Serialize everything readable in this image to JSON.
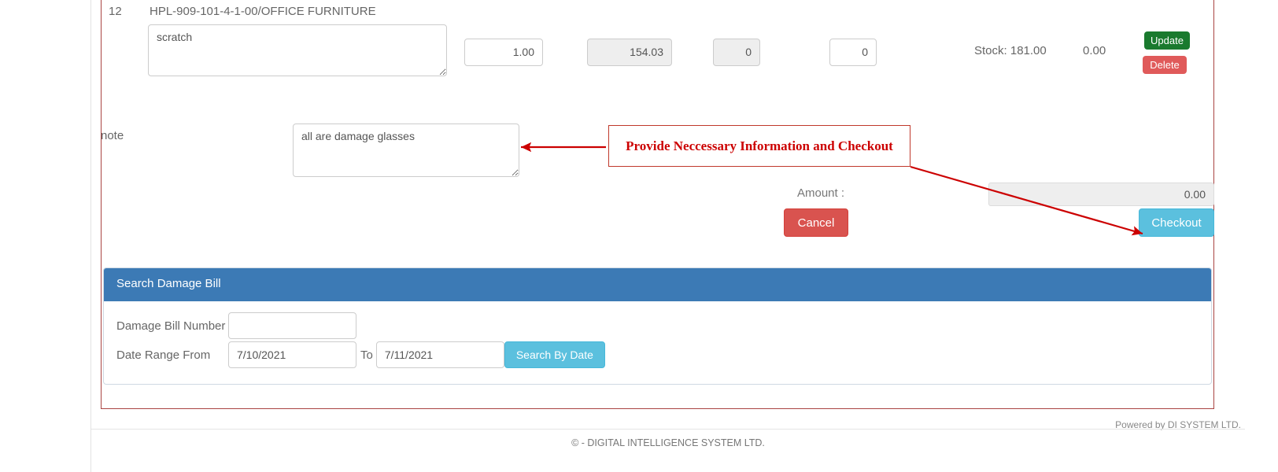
{
  "item_row": {
    "serial": "12",
    "code": "HPL-909-101-4-1-00/OFFICE FURNITURE",
    "remarks": "scratch",
    "quantity": "1.00",
    "rate": "154.03",
    "discount": "0",
    "vat": "0",
    "stock": "Stock: 181.00",
    "line_total": "0.00",
    "update_label": "Update",
    "delete_label": "Delete",
    "update_color": "#1a7a2e",
    "delete_color": "#e05a5a"
  },
  "note_row": {
    "label": "note",
    "value": "all are damage glasses"
  },
  "totals": {
    "amount_label": "Amount :",
    "amount_value": "0.00",
    "cancel_label": "Cancel",
    "checkout_label": "Checkout",
    "cancel_color": "#d9534f",
    "checkout_color": "#5bc0de"
  },
  "search_panel": {
    "title": "Search Damage Bill",
    "header_color": "#3c7ab5",
    "bill_number_label": "Damage Bill Number",
    "bill_number_value": "",
    "bill_number_placeholder": "",
    "date_from_label": "Date Range From",
    "date_from_value": "7/10/2021",
    "to_label": "To",
    "date_to_value": "7/11/2021",
    "search_button_label": "Search By Date"
  },
  "annotation": {
    "text": "Provide Neccessary Information and Checkout",
    "color": "#cc0000"
  },
  "footer": {
    "powered_by": "Powered by DI SYSTEM LTD.",
    "copyright": "©  - DIGITAL INTELLIGENCE SYSTEM LTD."
  }
}
